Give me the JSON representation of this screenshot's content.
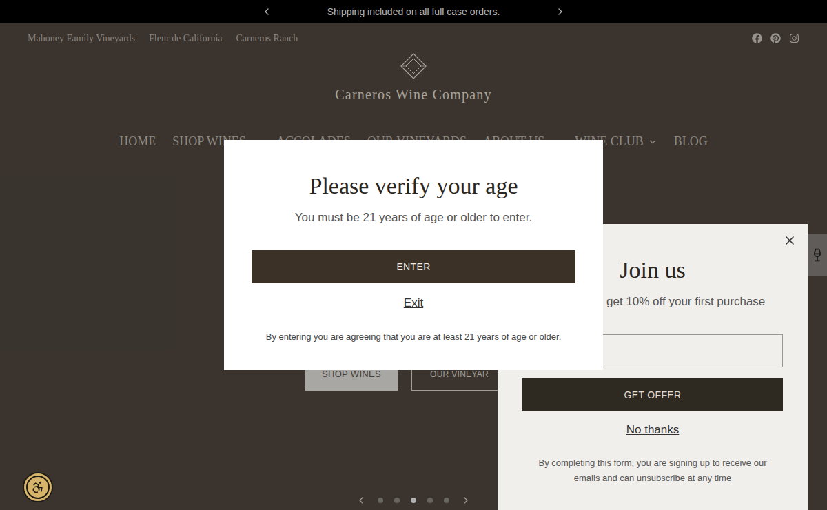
{
  "announcement": {
    "text": "Shipping included on all full case orders."
  },
  "top_links": [
    "Mahoney Family Vineyards",
    "Fleur de California",
    "Carneros Ranch"
  ],
  "logo": {
    "name": "Carneros Wine Company"
  },
  "nav": [
    {
      "label": "HOME",
      "dropdown": false
    },
    {
      "label": "SHOP WINES",
      "dropdown": true
    },
    {
      "label": "ACCOLADES",
      "dropdown": false
    },
    {
      "label": "OUR VINEYARDS",
      "dropdown": false
    },
    {
      "label": "ABOUT US",
      "dropdown": true
    },
    {
      "label": "WINE CLUB",
      "dropdown": true
    },
    {
      "label": "BLOG",
      "dropdown": false
    }
  ],
  "hero": {
    "buttons": [
      "SHOP WINES",
      "OUR VINEYAR"
    ],
    "slides": [
      {
        "selected": false
      },
      {
        "selected": false
      },
      {
        "selected": true
      },
      {
        "selected": false
      },
      {
        "selected": false
      }
    ]
  },
  "age_modal": {
    "title": "Please verify your age",
    "subtitle": "You must be 21 years of age or older to enter.",
    "enter": "ENTER",
    "exit": "Exit",
    "disclaimer": "By entering you are agreeing that you are at least 21 years of age or older."
  },
  "signup": {
    "title": "Join us",
    "subtitle": "get 10% off your first purchase",
    "button": "GET OFFER",
    "dismiss": "No thanks",
    "fine_print": "By completing this form, you are signing up to receive our emails and can unsubscribe at any time"
  }
}
